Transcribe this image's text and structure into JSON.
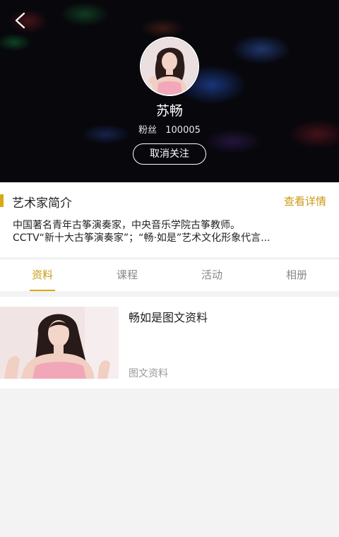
{
  "header": {
    "artist_name": "苏畅",
    "fans_label": "粉丝",
    "fans_count": "100005",
    "follow_button": "取消关注"
  },
  "intro": {
    "title": "艺术家简介",
    "more_link": "查看详情",
    "lines": [
      "中国著名青年古筝演奏家，中央音乐学院古筝教师。",
      "CCTV“新十大古筝演奏家”；“畅·如是”艺术文化形象代言..."
    ]
  },
  "tabs": [
    {
      "label": "资料",
      "active": true
    },
    {
      "label": "课程",
      "active": false
    },
    {
      "label": "活动",
      "active": false
    },
    {
      "label": "相册",
      "active": false
    }
  ],
  "content": {
    "items": [
      {
        "title": "畅如是图文资料",
        "tag": "图文资料"
      }
    ]
  },
  "colors": {
    "accent": "#d8a914",
    "accent_text": "#c99b12",
    "page_bg": "#f3f3f3"
  },
  "icons": {
    "back": "back-arrow-icon"
  }
}
